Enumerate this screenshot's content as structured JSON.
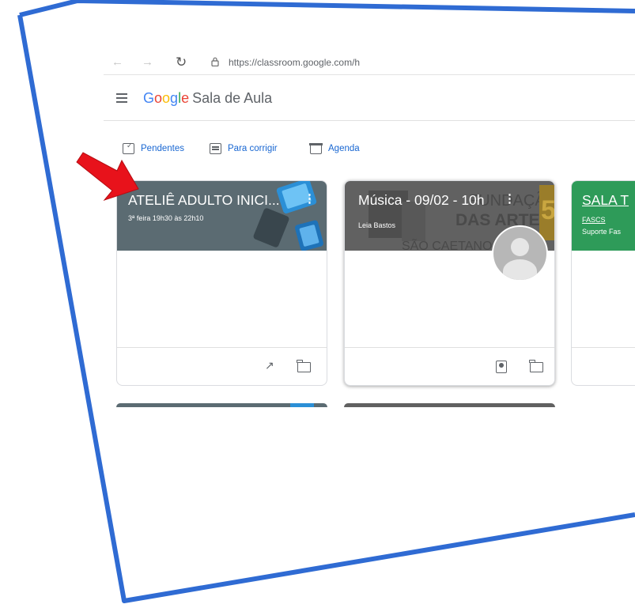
{
  "browser": {
    "url": "https://classroom.google.com/h",
    "back_icon": "arrow-left-icon",
    "forward_icon": "arrow-right-icon",
    "reload_icon": "reload-icon",
    "lock_icon": "lock-icon"
  },
  "header": {
    "menu_icon": "hamburger-icon",
    "brand": "Google",
    "app_title": "Sala de Aula"
  },
  "toolbar": {
    "pending_label": "Pendentes",
    "to_review_label": "Para corrigir",
    "calendar_label": "Agenda"
  },
  "classes": [
    {
      "title": "ATELIÊ ADULTO INICI...",
      "subtitle": "3ª feira 19h30 às 22h10",
      "banner_color": "#5b6b72",
      "footer_icons": [
        "trending-icon",
        "folder-icon"
      ]
    },
    {
      "title": "Música - 09/02 - 10h",
      "teacher": "Leia Bastos",
      "banner_text": [
        "FUNDAÇÃO",
        "DAS ARTES",
        "SÃO CAETANO DO"
      ],
      "banner_color": "#616161",
      "footer_icons": [
        "class-badge-icon",
        "folder-icon"
      ]
    },
    {
      "title": "SALA T",
      "section": "FASCS",
      "teacher": "Suporte Fas",
      "banner_color": "#2e9b59"
    }
  ],
  "annotation": {
    "arrow_color": "#e8121b",
    "frame_color": "#2f6bd3"
  }
}
